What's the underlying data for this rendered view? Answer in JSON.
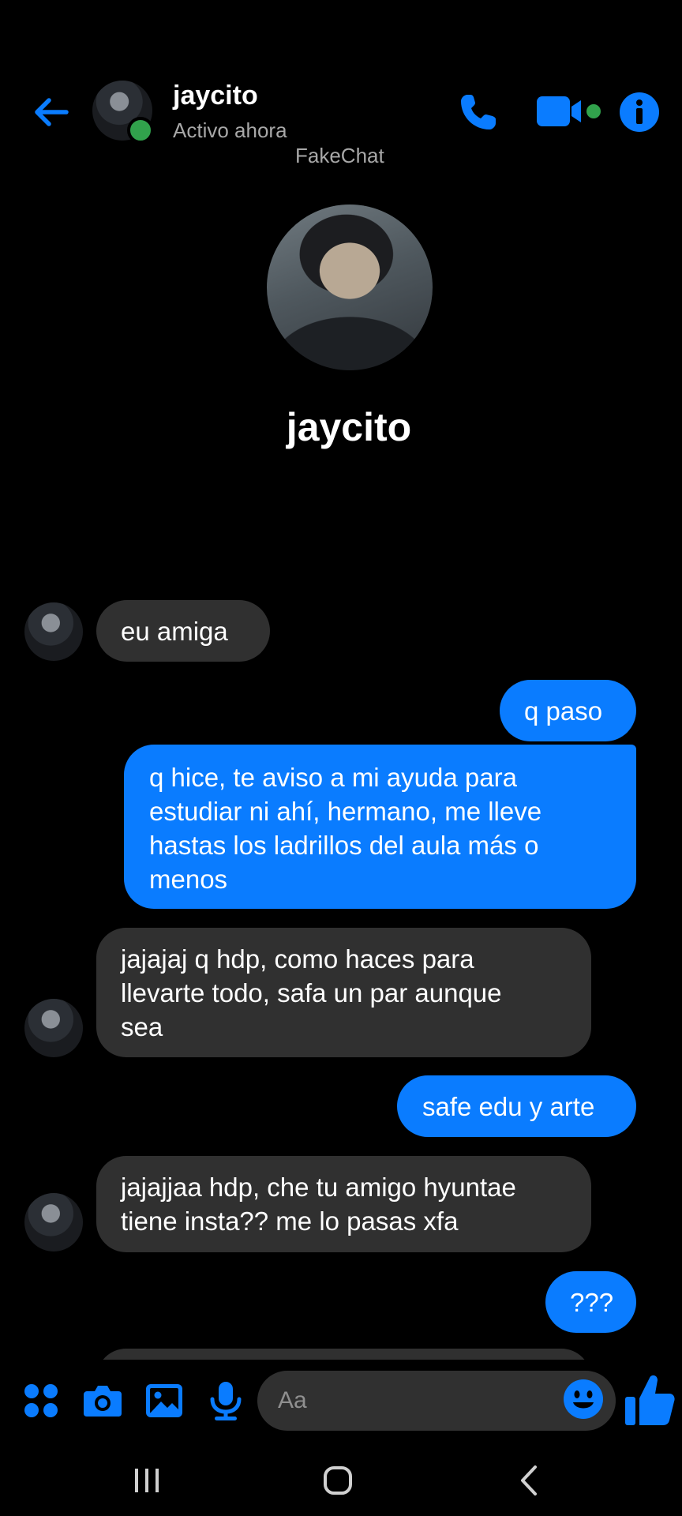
{
  "header": {
    "name": "jaycito",
    "status": "Activo ahora",
    "watermark": "FakeChat"
  },
  "profile": {
    "name": "jaycito"
  },
  "messages": [
    {
      "side": "in",
      "text": "eu amiga"
    },
    {
      "side": "out",
      "text": "q paso"
    },
    {
      "side": "out",
      "lines": [
        "q hice, te aviso a mi ayuda para",
        "estudiar ni ahí, hermano, me lleve",
        "hastas los ladrillos del aula más o",
        "menos"
      ]
    },
    {
      "side": "in",
      "lines": [
        "jajajaj q hdp, como haces para",
        "llevarte todo, safa un par aunque",
        "sea"
      ]
    },
    {
      "side": "out",
      "text": "safe edu y arte"
    },
    {
      "side": "in",
      "lines": [
        "jajajjaa hdp, che tu amigo hyuntae",
        "tiene insta?? me lo pasas xfa"
      ]
    },
    {
      "side": "out",
      "text": "???"
    }
  ],
  "composer": {
    "placeholder": "Aa"
  },
  "icons": {
    "back": "arrow-left-icon",
    "call": "phone-icon",
    "video": "video-camera-icon",
    "info": "info-icon",
    "apps": "apps-grid-icon",
    "camera": "camera-icon",
    "gallery": "image-icon",
    "mic": "microphone-icon",
    "emoji": "smiley-icon",
    "like": "thumbs-up-icon"
  },
  "colors": {
    "accent": "#0a7cff",
    "incoming_bubble": "#303030",
    "online": "#31a24c",
    "background": "#000000"
  }
}
